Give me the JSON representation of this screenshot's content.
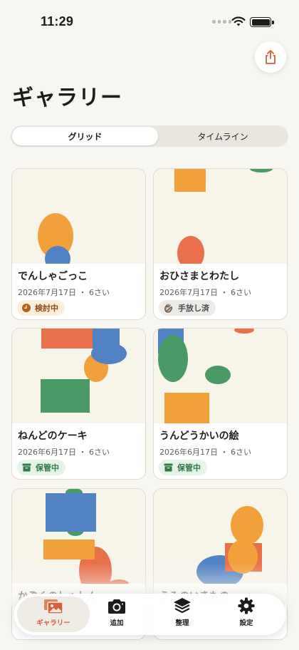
{
  "status": {
    "time": "11:29"
  },
  "header": {
    "title": "ギャラリー",
    "share_icon": "share-icon"
  },
  "segmented": {
    "grid": "グリッド",
    "timeline": "タイムライン",
    "selected": "grid"
  },
  "cards": [
    {
      "title": "でんしゃごっこ",
      "date": "2026年7月17日 ・ 6さい",
      "badge": "検討中",
      "badge_icon": "clock-icon"
    },
    {
      "title": "おひさまとわたし",
      "date": "2026年7月17日 ・ 6さい",
      "badge": "手放し済",
      "badge_icon": "wave-hand-icon"
    },
    {
      "title": "ねんどのケーキ",
      "date": "2026年6月17日 ・ 6さい",
      "badge": "保管中",
      "badge_icon": "archive-box-icon"
    },
    {
      "title": "うんどうかいの絵",
      "date": "2026年6月17日 ・ 6さい",
      "badge": "保管中",
      "badge_icon": "archive-box-icon"
    },
    {
      "title": "かぞくのしゃしん",
      "date": "",
      "badge": ""
    },
    {
      "title": "うみのいきもの",
      "date": "",
      "badge": ""
    }
  ],
  "tabs": [
    {
      "label": "ギャラリー",
      "icon": "photo-gallery-icon",
      "active": true
    },
    {
      "label": "追加",
      "icon": "camera-icon",
      "active": false
    },
    {
      "label": "整理",
      "icon": "stack-layers-icon",
      "active": false
    },
    {
      "label": "設定",
      "icon": "gear-icon",
      "active": false
    }
  ],
  "colors": {
    "accent": "#d85f38",
    "orange": "#f2a03a",
    "blue": "#5082c4",
    "red": "#e8704a",
    "green": "#4a9a66",
    "background": "#f8f6f0"
  }
}
